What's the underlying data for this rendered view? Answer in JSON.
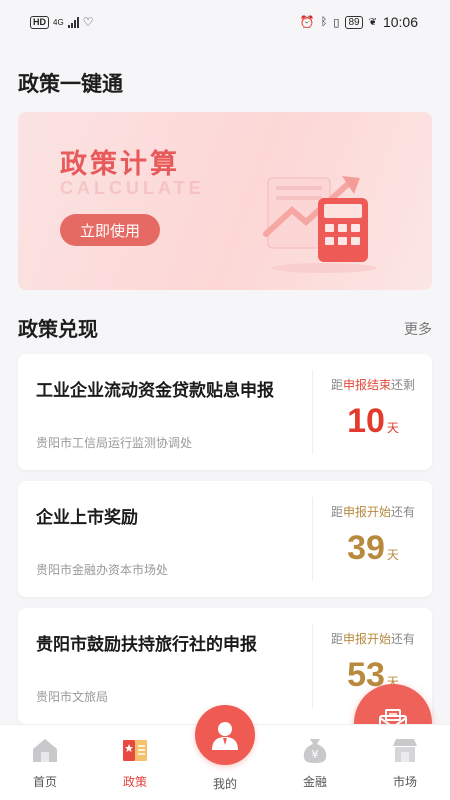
{
  "status_bar": {
    "hd": "HD",
    "network": "4G",
    "battery": "89",
    "time": "10:06"
  },
  "page": {
    "title": "政策一键通"
  },
  "banner": {
    "title": "政策计算",
    "subtitle": "CALCULATE",
    "button_label": "立即使用"
  },
  "section": {
    "title": "政策兑现",
    "more_label": "更多"
  },
  "cards": [
    {
      "title": "工业企业流动资金贷款贴息申报",
      "dept": "贵阳市工信局运行监测协调处",
      "status_prefix": "距",
      "status_highlight": "申报结束",
      "status_suffix": "还剩",
      "days": "10",
      "unit": "天",
      "tone": "red"
    },
    {
      "title": "企业上市奖励",
      "dept": "贵阳市金融办资本市场处",
      "status_prefix": "距",
      "status_highlight": "申报开始",
      "status_suffix": "还有",
      "days": "39",
      "unit": "天",
      "tone": "gold"
    },
    {
      "title": "贵阳市鼓励扶持旅行社的申报",
      "dept": "贵阳市文旅局",
      "status_prefix": "距",
      "status_highlight": "申报开始",
      "status_suffix": "还有",
      "days": "53",
      "unit": "天",
      "tone": "gold"
    }
  ],
  "nav": {
    "items": [
      {
        "label": "首页",
        "icon": "home-icon"
      },
      {
        "label": "政策",
        "icon": "policy-book-icon"
      },
      {
        "label": "我的",
        "icon": "user-icon"
      },
      {
        "label": "金融",
        "icon": "money-bag-icon"
      },
      {
        "label": "市场",
        "icon": "market-shop-icon"
      }
    ],
    "active": "政策"
  },
  "colors": {
    "accent": "#ef5b52",
    "red_days": "#e23a2c",
    "gold_days": "#b88a3e"
  }
}
